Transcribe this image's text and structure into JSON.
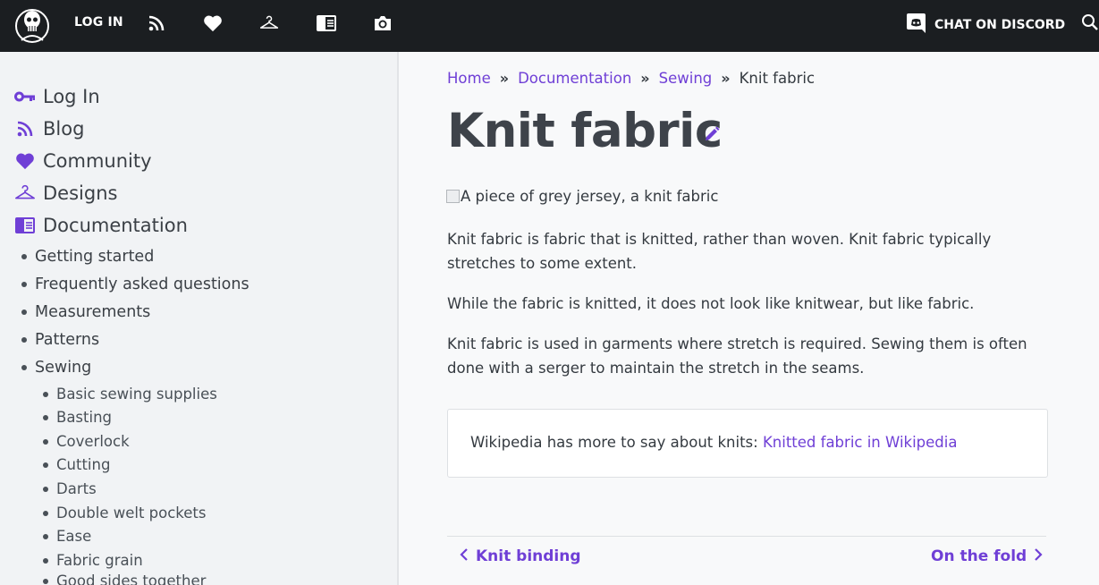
{
  "topbar": {
    "login_label": "LOG IN",
    "icons": [
      "rss-icon",
      "heart-icon",
      "hanger-icon",
      "documentation-icon",
      "camera-icon"
    ],
    "discord_label": "CHAT ON DISCORD"
  },
  "sidebar": {
    "top_items": [
      {
        "label": "Log In",
        "icon": "key-icon"
      },
      {
        "label": "Blog",
        "icon": "rss-icon"
      },
      {
        "label": "Community",
        "icon": "heart-icon"
      },
      {
        "label": "Designs",
        "icon": "hanger-icon"
      },
      {
        "label": "Documentation",
        "icon": "documentation-icon"
      }
    ],
    "doc_items": [
      "Getting started",
      "Frequently asked questions",
      "Measurements",
      "Patterns",
      "Sewing"
    ],
    "sewing_items": [
      "Basic sewing supplies",
      "Basting",
      "Coverlock",
      "Cutting",
      "Darts",
      "Double welt pockets",
      "Ease",
      "Fabric grain",
      "Good sides together"
    ]
  },
  "breadcrumb": {
    "items": [
      "Home",
      "Documentation",
      "Sewing"
    ],
    "separator": "»",
    "current": "Knit fabric"
  },
  "page": {
    "title": "Knit fabric",
    "image_alt": "A piece of grey jersey, a knit fabric",
    "paragraphs": [
      "Knit fabric is fabric that is knitted, rather than woven. Knit fabric typically stretches to some extent.",
      "While the fabric is knitted, it does not look like knitwear, but like fabric.",
      "Knit fabric is used in garments where stretch is required. Sewing them is often done with a serger to maintain the stretch in the seams."
    ],
    "wiki_text": "Wikipedia has more to say about knits: ",
    "wiki_link": "Knitted fabric in Wikipedia"
  },
  "pager": {
    "prev": "Knit binding",
    "next": "On the fold"
  },
  "colors": {
    "accent": "#6f3fd6",
    "topbar": "#1b1e21",
    "sidebar_bg": "#f1f3f5",
    "text": "#343a40"
  }
}
